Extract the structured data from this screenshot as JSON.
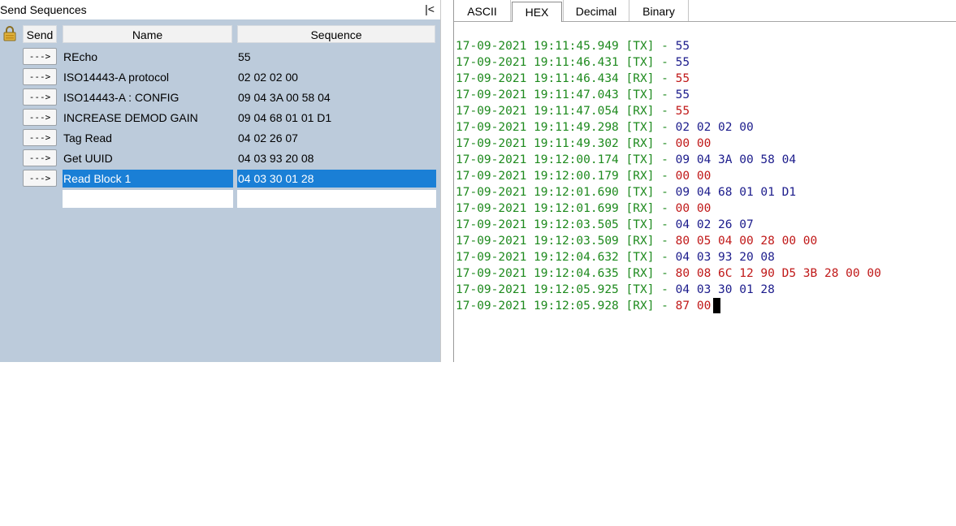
{
  "left": {
    "title": "Send Sequences",
    "collapse_label": "|<",
    "columns": {
      "send": "Send",
      "name": "Name",
      "sequence": "Sequence"
    },
    "button_label": "--->",
    "rows": [
      {
        "name": "REcho",
        "sequence": "55"
      },
      {
        "name": " ISO14443-A protocol",
        "sequence": "02 02 02 00"
      },
      {
        "name": "ISO14443-A : CONFIG",
        "sequence": "09 04 3A 00 58 04"
      },
      {
        "name": "INCREASE DEMOD GAIN",
        "sequence": "09 04 68 01 01 D1"
      },
      {
        "name": "Tag Read",
        "sequence": "04 02 26 07"
      },
      {
        "name": "Get UUID",
        "sequence": "04 03 93 20 08"
      },
      {
        "name": "Read Block 1",
        "sequence": "04 03 30 01 28",
        "selected": true
      }
    ]
  },
  "tabs": [
    {
      "label": "ASCII"
    },
    {
      "label": "HEX",
      "active": true
    },
    {
      "label": "Decimal"
    },
    {
      "label": "Binary"
    }
  ],
  "log": [
    {
      "ts": "17-09-2021 19:11:45.949",
      "dir": "[TX]",
      "sep": " - ",
      "data": "55"
    },
    {
      "ts": "17-09-2021 19:11:46.431",
      "dir": "[TX]",
      "sep": " - ",
      "data": "55"
    },
    {
      "ts": "17-09-2021 19:11:46.434",
      "dir": "[RX]",
      "sep": " - ",
      "data": "55"
    },
    {
      "ts": "17-09-2021 19:11:47.043",
      "dir": "[TX]",
      "sep": " - ",
      "data": "55"
    },
    {
      "ts": "17-09-2021 19:11:47.054",
      "dir": "[RX]",
      "sep": " - ",
      "data": "55"
    },
    {
      "ts": "17-09-2021 19:11:49.298",
      "dir": "[TX]",
      "sep": " - ",
      "data": "02 02 02 00"
    },
    {
      "ts": "17-09-2021 19:11:49.302",
      "dir": "[RX]",
      "sep": " - ",
      "data": "00 00"
    },
    {
      "ts": "17-09-2021 19:12:00.174",
      "dir": "[TX]",
      "sep": " - ",
      "data": "09 04 3A 00 58 04"
    },
    {
      "ts": "17-09-2021 19:12:00.179",
      "dir": "[RX]",
      "sep": " - ",
      "data": "00 00"
    },
    {
      "ts": "17-09-2021 19:12:01.690",
      "dir": "[TX]",
      "sep": " - ",
      "data": "09 04 68 01 01 D1"
    },
    {
      "ts": "17-09-2021 19:12:01.699",
      "dir": "[RX]",
      "sep": " - ",
      "data": "00 00"
    },
    {
      "ts": "17-09-2021 19:12:03.505",
      "dir": "[TX]",
      "sep": " - ",
      "data": "04 02 26 07"
    },
    {
      "ts": "17-09-2021 19:12:03.509",
      "dir": "[RX]",
      "sep": " - ",
      "data": "80 05 04 00 28 00 00"
    },
    {
      "ts": "17-09-2021 19:12:04.632",
      "dir": "[TX]",
      "sep": " - ",
      "data": "04 03 93 20 08"
    },
    {
      "ts": "17-09-2021 19:12:04.635",
      "dir": "[RX]",
      "sep": " - ",
      "data": "80 08 6C 12 90 D5 3B 28 00 00"
    },
    {
      "ts": "17-09-2021 19:12:05.925",
      "dir": "[TX]",
      "sep": " - ",
      "data": "04 03 30 01 28"
    },
    {
      "ts": "17-09-2021 19:12:05.928",
      "dir": "[RX]",
      "sep": " - ",
      "data": "87 00",
      "cursor": true
    }
  ],
  "colors": {
    "timestamp": "#1e8a1e",
    "tx": "#1c1c8c",
    "rx": "#c01818",
    "selection": "#1a7fd6",
    "panel": "#bccbdb"
  },
  "icons": {
    "lock": "lock-icon"
  }
}
